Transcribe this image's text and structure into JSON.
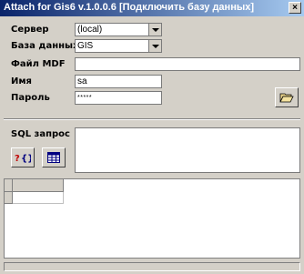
{
  "window": {
    "title": "Attach for Gis6 v.1.0.0.6 [Подключить базу данных]",
    "close_glyph": "×"
  },
  "form": {
    "server": {
      "label": "Сервер",
      "value": "(local)"
    },
    "database": {
      "label": "База данных",
      "value": "GIS"
    },
    "mdf": {
      "label": "Файл MDF",
      "value": ""
    },
    "username": {
      "label": "Имя",
      "value": "sa"
    },
    "password": {
      "label": "Пароль",
      "value": "*****"
    }
  },
  "sql": {
    "label": "SQL запрос",
    "value": ""
  },
  "icons": {
    "folder": "folder-open-icon",
    "query": "query-icon",
    "table": "table-icon"
  },
  "colors": {
    "titlebar_start": "#0a246a",
    "titlebar_end": "#a6caf0",
    "face": "#d4d0c8"
  }
}
